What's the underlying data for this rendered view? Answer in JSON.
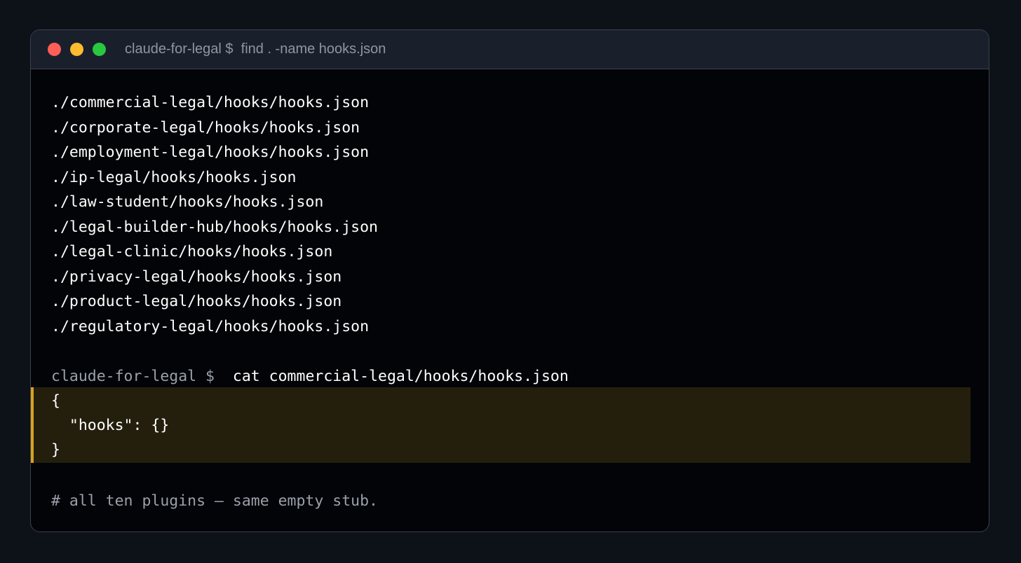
{
  "window": {
    "title": "claude-for-legal $  find . -name hooks.json"
  },
  "output": {
    "files": [
      "./commercial-legal/hooks/hooks.json",
      "./corporate-legal/hooks/hooks.json",
      "./employment-legal/hooks/hooks.json",
      "./ip-legal/hooks/hooks.json",
      "./law-student/hooks/hooks.json",
      "./legal-builder-hub/hooks/hooks.json",
      "./legal-clinic/hooks/hooks.json",
      "./privacy-legal/hooks/hooks.json",
      "./product-legal/hooks/hooks.json",
      "./regulatory-legal/hooks/hooks.json"
    ]
  },
  "command": {
    "prompt": "claude-for-legal $",
    "text": "cat commercial-legal/hooks/hooks.json"
  },
  "json_output": [
    "{",
    "  \"hooks\": {}",
    "}"
  ],
  "comment": "# all ten plugins — same empty stub.",
  "colors": {
    "window_bg": "#020408",
    "titlebar_bg": "#1a202b",
    "highlight_bg": "#241f0d",
    "highlight_border": "#d8a21e",
    "text": "#ffffff",
    "muted": "#9aa0aa"
  },
  "icons": [
    "close-dot-icon",
    "minimize-dot-icon",
    "maximize-dot-icon"
  ]
}
